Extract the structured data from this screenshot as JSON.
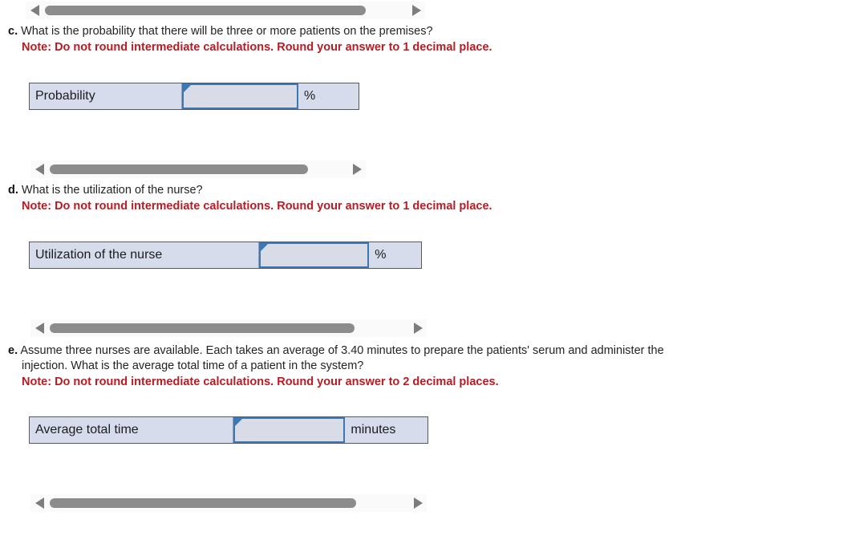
{
  "sections": [
    {
      "id": "c",
      "letter": "c.",
      "question": "What is the probability that there will be three or more patients on the premises?",
      "note": "Note: Do not round intermediate calculations. Round your answer to 1 decimal place.",
      "answer_label": "Probability",
      "answer_value": "",
      "unit": "%"
    },
    {
      "id": "d",
      "letter": "d.",
      "question": "What is the utilization of the nurse?",
      "note": "Note: Do not round intermediate calculations. Round your answer to 1 decimal place.",
      "answer_label": "Utilization of the nurse",
      "answer_value": "",
      "unit": "%"
    },
    {
      "id": "e",
      "letter": "e.",
      "question_line1": "Assume three nurses are available. Each takes an average of 3.40 minutes to prepare the patients' serum and administer the",
      "question_line2": "injection. What is the average total time of a patient in the system?",
      "note": "Note: Do not round intermediate calculations. Round your answer to 2 decimal places.",
      "answer_label": "Average total time",
      "answer_value": "",
      "unit": "minutes"
    }
  ],
  "scrollbars": [
    {
      "id": "scrollbar-1",
      "left_arrow": "left-arrow-icon",
      "right_arrow": "right-arrow-icon"
    },
    {
      "id": "scrollbar-2",
      "left_arrow": "left-arrow-icon",
      "right_arrow": "right-arrow-icon"
    },
    {
      "id": "scrollbar-3",
      "left_arrow": "left-arrow-icon",
      "right_arrow": "right-arrow-icon"
    },
    {
      "id": "scrollbar-4",
      "left_arrow": "left-arrow-icon",
      "right_arrow": "right-arrow-icon"
    }
  ],
  "colors": {
    "note_red": "#b81b22",
    "table_fill": "#d7dced",
    "input_border": "#3b78b5",
    "scrollbar_thumb": "#8c8c8c",
    "scrollbar_arrow": "#7d7d7d",
    "table_border": "#58595b"
  }
}
